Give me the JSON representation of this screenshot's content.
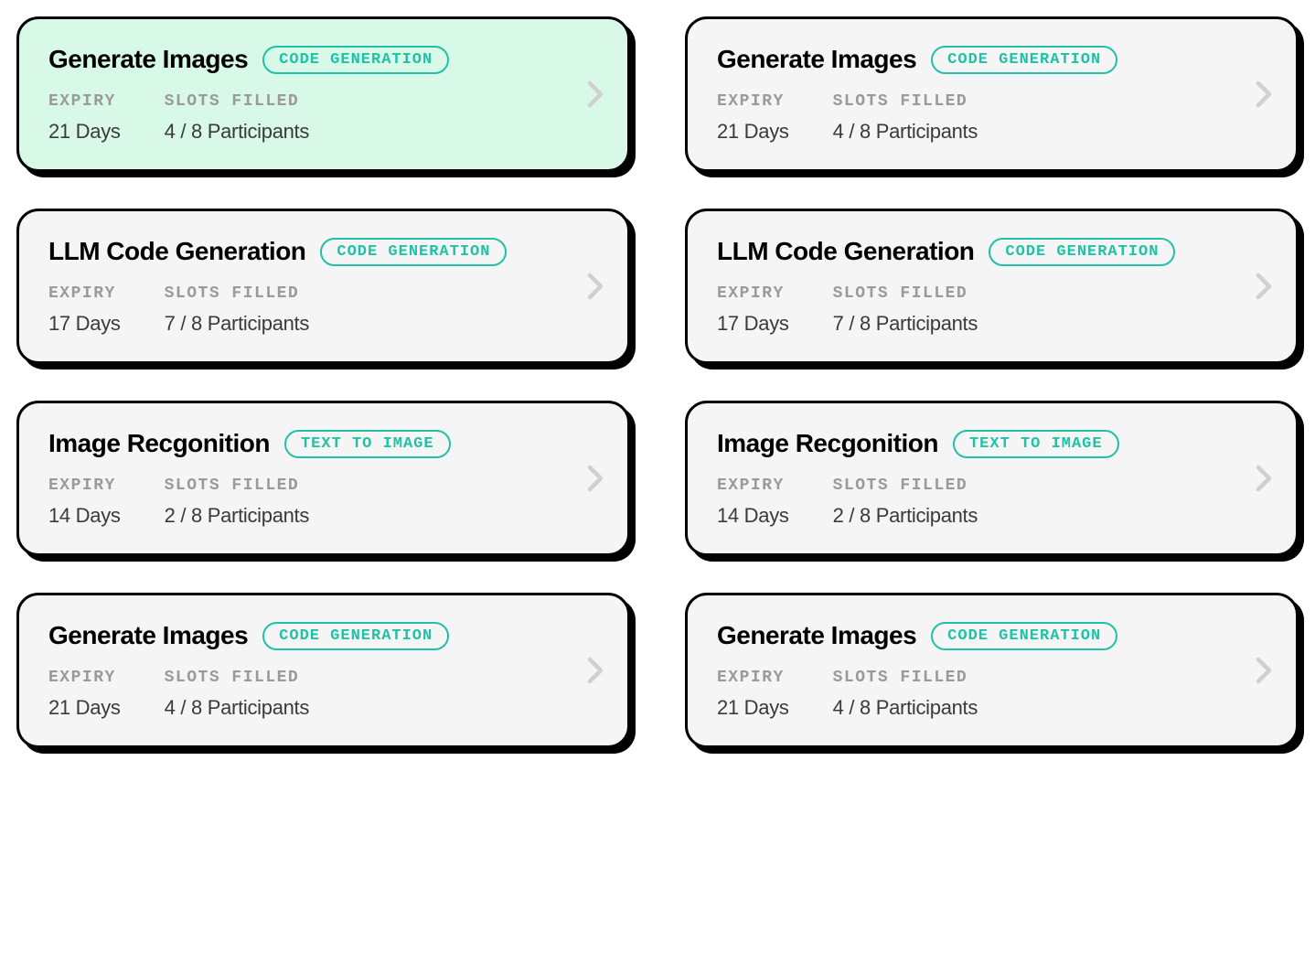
{
  "labels": {
    "expiry": "EXPIRY",
    "slots_filled": "SLOTS FILLED"
  },
  "cards": [
    {
      "title": "Generate Images",
      "badge": "CODE GENERATION",
      "expiry": "21 Days",
      "slots": "4 / 8 Participants",
      "highlighted": true
    },
    {
      "title": "Generate Images",
      "badge": "CODE GENERATION",
      "expiry": "21 Days",
      "slots": "4 / 8 Participants",
      "highlighted": false
    },
    {
      "title": "LLM Code Generation",
      "badge": "CODE GENERATION",
      "expiry": "17 Days",
      "slots": "7 / 8 Participants",
      "highlighted": false
    },
    {
      "title": "LLM Code Generation",
      "badge": "CODE GENERATION",
      "expiry": "17 Days",
      "slots": "7 / 8 Participants",
      "highlighted": false
    },
    {
      "title": "Image Recgonition",
      "badge": "TEXT TO IMAGE",
      "expiry": "14 Days",
      "slots": "2 / 8 Participants",
      "highlighted": false
    },
    {
      "title": "Image Recgonition",
      "badge": "TEXT TO IMAGE",
      "expiry": "14 Days",
      "slots": "2 / 8 Participants",
      "highlighted": false
    },
    {
      "title": "Generate Images",
      "badge": "CODE GENERATION",
      "expiry": "21 Days",
      "slots": "4 / 8 Participants",
      "highlighted": false
    },
    {
      "title": "Generate Images",
      "badge": "CODE GENERATION",
      "expiry": "21 Days",
      "slots": "4 / 8 Participants",
      "highlighted": false
    }
  ],
  "colors": {
    "accent": "#1fc2a7",
    "highlight_bg": "#d8f8e8",
    "card_bg": "#f5f5f5",
    "border": "#000000"
  }
}
